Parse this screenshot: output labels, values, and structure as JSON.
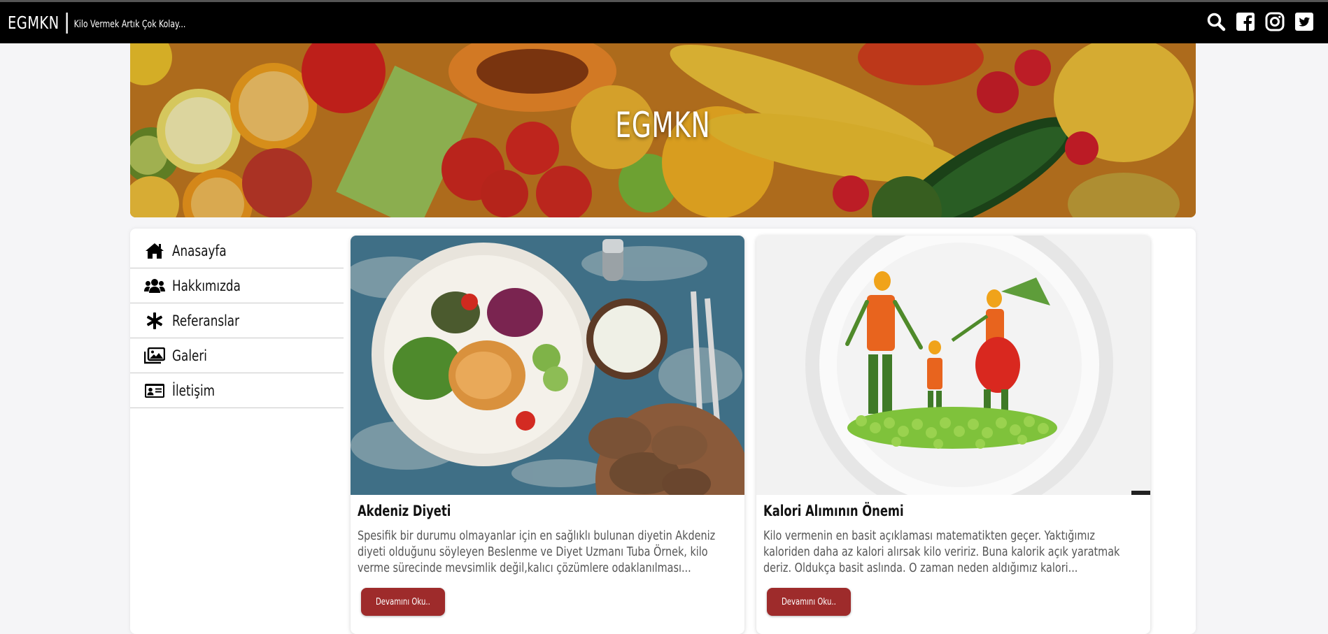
{
  "header": {
    "brand": "EGMKN",
    "tagline": "Kilo Vermek Artık Çok Kolay..."
  },
  "icons": {
    "search": "search-icon",
    "facebook": "facebook-icon",
    "instagram": "instagram-icon",
    "twitter": "twitter-icon"
  },
  "hero": {
    "title": "EGMKN"
  },
  "sidebar": {
    "items": [
      {
        "label": "Anasayfa",
        "icon": "home-icon"
      },
      {
        "label": "Hakkımızda",
        "icon": "users-icon"
      },
      {
        "label": "Referanslar",
        "icon": "asterisk-icon"
      },
      {
        "label": "Galeri",
        "icon": "images-icon"
      },
      {
        "label": "İletişim",
        "icon": "id-card-icon"
      }
    ]
  },
  "cards": [
    {
      "title": "Akdeniz Diyeti",
      "text": "Spesifik bir durumu olmayanlar için en sağlıklı bulunan diyetin Akdeniz diyeti olduğunu söyleyen Beslenme ve Diyet Uzmanı Tuba Örnek, kilo verme sürecinde mevsimlik değil,kalıcı çözümlere odaklanılması...",
      "button": "Devamını Oku.."
    },
    {
      "title": "Kalori Alımının Önemi",
      "text": "Kilo vermenin en basit açıklaması matematikten geçer. Yaktığımız kaloriden daha az kalori alırsak kilo veririz. Buna kalorik açık yaratmak deriz. Oldukça basit aslında. O zaman neden aldığımız kalori...",
      "button": "Devamını Oku.."
    }
  ],
  "colors": {
    "topbar": "#000000",
    "button": "#9e2b2b",
    "background": "#f5f5f7"
  }
}
